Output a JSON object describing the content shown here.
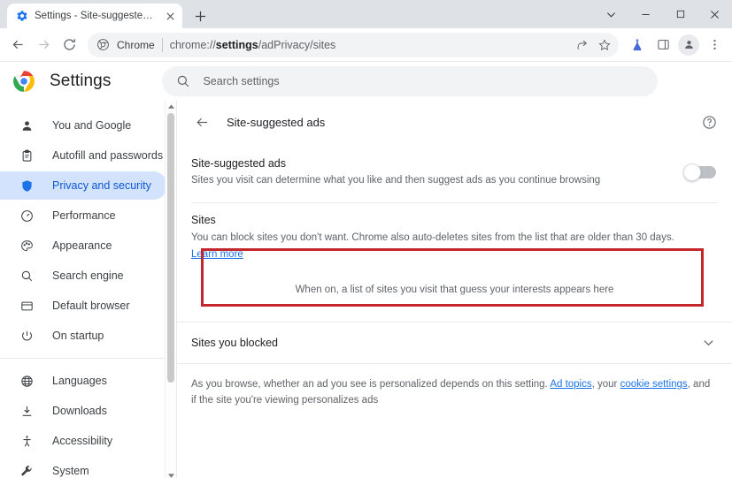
{
  "browser": {
    "tab": {
      "title": "Settings - Site-suggested ads",
      "favicon": "gear-icon",
      "close_label": "×"
    },
    "new_tab_label": "+",
    "window_controls": {
      "tab_search": "tab-search-icon",
      "minimize": "minimize-icon",
      "maximize": "maximize-icon",
      "close": "close-icon"
    },
    "toolbar": {
      "back": "back-arrow-icon",
      "forward": "forward-arrow-icon",
      "reload": "reload-icon",
      "omnibox": {
        "chip_icon": "chrome-icon",
        "chip_label": "Chrome",
        "url_prefix": "chrome://",
        "url_bold": "settings",
        "url_suffix": "/adPrivacy/sites"
      },
      "actions": {
        "share": "share-icon",
        "bookmark": "star-icon",
        "experiments": "flask-icon",
        "side_panel": "side-panel-icon",
        "profile": "avatar-icon",
        "menu": "three-dot-menu-icon"
      }
    }
  },
  "settings": {
    "logo": "chrome-logo",
    "title": "Settings",
    "search": {
      "icon": "search-icon",
      "placeholder": "Search settings"
    }
  },
  "sidebar": {
    "groups": [
      {
        "items": [
          {
            "label": "You and Google",
            "icon": "person-icon",
            "active": false
          },
          {
            "label": "Autofill and passwords",
            "icon": "clipboard-icon",
            "active": false
          },
          {
            "label": "Privacy and security",
            "icon": "shield-icon",
            "active": true
          },
          {
            "label": "Performance",
            "icon": "speedometer-icon",
            "active": false
          },
          {
            "label": "Appearance",
            "icon": "palette-icon",
            "active": false
          },
          {
            "label": "Search engine",
            "icon": "search-icon",
            "active": false
          },
          {
            "label": "Default browser",
            "icon": "browser-window-icon",
            "active": false
          },
          {
            "label": "On startup",
            "icon": "power-icon",
            "active": false
          }
        ]
      },
      {
        "items": [
          {
            "label": "Languages",
            "icon": "globe-icon",
            "active": false
          },
          {
            "label": "Downloads",
            "icon": "download-icon",
            "active": false
          },
          {
            "label": "Accessibility",
            "icon": "accessibility-icon",
            "active": false
          },
          {
            "label": "System",
            "icon": "wrench-icon",
            "active": false
          }
        ]
      }
    ]
  },
  "page": {
    "back_icon": "back-arrow-icon",
    "title": "Site-suggested ads",
    "help_icon": "help-circle-icon",
    "highlight_color": "#c3272b",
    "toggle_row": {
      "title": "Site-suggested ads",
      "description": "Sites you visit can determine what you like and then suggest ads as you continue browsing",
      "toggle_state": "off"
    },
    "sites_section": {
      "heading": "Sites",
      "description": "You can block sites you don't want. Chrome also auto-deletes sites from the list that are older than 30 days.",
      "learn_more": "Learn more",
      "empty_message": "When on, a list of sites you visit that guess your interests appears here"
    },
    "blocked_section": {
      "title": "Sites you blocked",
      "chevron": "chevron-down-icon"
    },
    "footer": {
      "part1": "As you browse, whether an ad you see is personalized depends on this setting. ",
      "link1": "Ad topics",
      "part2": ", your ",
      "link2": "cookie settings",
      "part3": ", and if the site you're viewing personalizes ads"
    }
  },
  "colors": {
    "accent": "#1a73e8",
    "active_nav_bg": "#d3e3fd",
    "active_nav_fg": "#0b57d0",
    "highlight": "#c3272b"
  }
}
